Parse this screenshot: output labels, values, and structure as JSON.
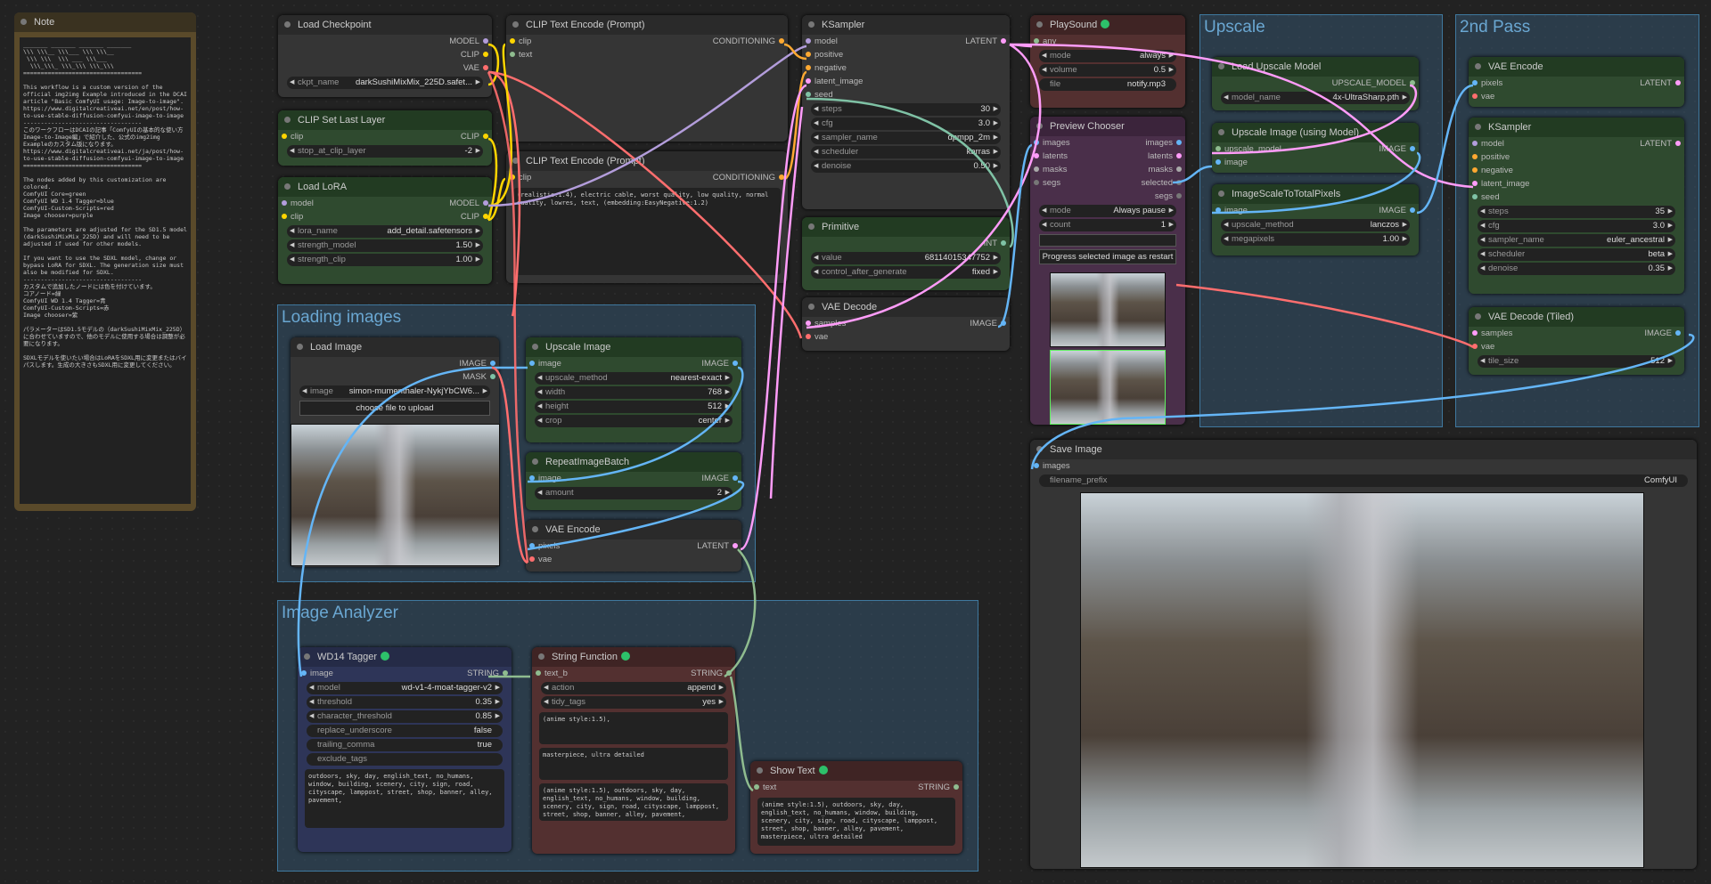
{
  "note": {
    "title": "Note",
    "body": "_______ _______ _______ _______\n\\\\\\ \\\\\\__ \\\\\\___ \\\\\\ \\\\\\__\n \\\\\\ \\\\\\  \\\\\\ ___ \\\\\\___\n  \\\\\\_\\\\\\_ \\\\\\_\\\\\\ \\\\\\_\\\\\\\n==================================\n\nThis workflow is a custom version of the official img2img Example introduced in the DCAI article \"Basic ComfyUI usage: Image-to-image\".\nhttps://www.digitalcreativeai.net/en/post/how-to-use-stable-diffusion-comfyui-image-to-image\n----------------------------------\nこのワークフローはDCAIの記事「ComfyUIの基本的な使い方 Image-to-Image編」で紹介した、公式のimg2img Exampleのカスタム版になります。\nhttps://www.digitalcreativeai.net/ja/post/how-to-use-stable-diffusion-comfyui-image-to-image\n==================================\n\nThe nodes added by this customization are colored.\nComfyUI Core=green\nComfyUI WD 1.4 Tagger=blue\nComfyUI-Custom-Scripts=red\nImage chooser=purple\n\nThe parameters are adjusted for the SD1.5 model (darkSushiMixMix_225D) and will need to be adjusted if used for other models.\n\nIf you want to use the SDXL model, change or bypass LoRA for SDXL. The generation size must also be modified for SDXL.\n----------------------------------\nカスタムで追加したノードには色を付けています。\nコアノード=緑\nComfyUI WD 1.4 Tagger=青\nComfyUI-Custom-Scripts=赤\nImage chooser=紫\n\nパラメーターはSD1.5モデルの（darkSushiMixMix_225D）に合わせていますので、他のモデルに使用する場合は調整が必要になります。\n\nSDXLモデルを使いたい場合はLoRAをSDXL用に変更またはバイパスします。生成の大きさもSDXL用に変更してください。"
  },
  "groups": {
    "loading": "Loading images",
    "analyzer": "Image Analyzer",
    "upscale": "Upscale",
    "second": "2nd Pass"
  },
  "load_checkpoint": {
    "title": "Load Checkpoint",
    "outputs": [
      "MODEL",
      "CLIP",
      "VAE"
    ],
    "ckpt_label": "ckpt_name",
    "ckpt_value": "darkSushiMixMix_225D.safet..."
  },
  "clip_last_layer": {
    "title": "CLIP Set Last Layer",
    "in": "clip",
    "out": "CLIP",
    "stop_label": "stop_at_clip_layer",
    "stop_value": "-2"
  },
  "load_lora": {
    "title": "Load LoRA",
    "in_model": "model",
    "in_clip": "clip",
    "out_model": "MODEL",
    "out_clip": "CLIP",
    "lora_label": "lora_name",
    "lora_value": "add_detail.safetensors",
    "sm_label": "strength_model",
    "sm_value": "1.50",
    "sc_label": "strength_clip",
    "sc_value": "1.00"
  },
  "clip_pos": {
    "title": "CLIP Text Encode (Prompt)",
    "in_clip": "clip",
    "in_text": "text",
    "out": "CONDITIONING"
  },
  "clip_neg": {
    "title": "CLIP Text Encode (Prompt)",
    "in_clip": "clip",
    "out": "CONDITIONING",
    "text": "(realistic:1.4), electric cable, worst quality, low quality, normal quality, lowres, text, (embedding:EasyNegative:1.2)"
  },
  "ksampler": {
    "title": "KSampler",
    "inputs": [
      "model",
      "positive",
      "negative",
      "latent_image",
      "seed"
    ],
    "out": "LATENT",
    "widgets": [
      {
        "label": "steps",
        "value": "30"
      },
      {
        "label": "cfg",
        "value": "3.0"
      },
      {
        "label": "sampler_name",
        "value": "dpmpp_2m"
      },
      {
        "label": "scheduler",
        "value": "karras"
      },
      {
        "label": "denoise",
        "value": "0.50"
      }
    ]
  },
  "primitive": {
    "title": "Primitive",
    "out": "INT",
    "value_label": "value",
    "value": "68114015347752",
    "cag_label": "control_after_generate",
    "cag_value": "fixed"
  },
  "vae_decode": {
    "title": "VAE Decode",
    "in_samples": "samples",
    "in_vae": "vae",
    "out": "IMAGE"
  },
  "playsound": {
    "title": "PlaySound",
    "in": "any",
    "mode_label": "mode",
    "mode_value": "always",
    "volume_label": "volume",
    "volume_value": "0.5",
    "file_label": "file",
    "file_value": "notify.mp3"
  },
  "preview_chooser": {
    "title": "Preview Chooser",
    "inputs": [
      "images",
      "latents",
      "masks",
      "segs"
    ],
    "outputs": [
      "images",
      "latents",
      "masks",
      "selected",
      "segs"
    ],
    "mode_label": "mode",
    "mode_value": "Always pause",
    "count_label": "count",
    "count_value": "1",
    "button": "Progress selected image as restart"
  },
  "load_upscale_model": {
    "title": "Load Upscale Model",
    "out": "UPSCALE_MODEL",
    "label": "model_name",
    "value": "4x-UltraSharp.pth"
  },
  "upscale_using_model": {
    "title": "Upscale Image (using Model)",
    "in_model": "upscale_model",
    "in_image": "image",
    "out": "IMAGE"
  },
  "scale_total": {
    "title": "ImageScaleToTotalPixels",
    "in": "image",
    "out": "IMAGE",
    "m_label": "upscale_method",
    "m_value": "lanczos",
    "mp_label": "megapixels",
    "mp_value": "1.00"
  },
  "vae_encode2": {
    "title": "VAE Encode",
    "in_pixels": "pixels",
    "in_vae": "vae",
    "out": "LATENT"
  },
  "ksampler2": {
    "title": "KSampler",
    "inputs": [
      "model",
      "positive",
      "negative",
      "latent_image",
      "seed"
    ],
    "out": "LATENT",
    "widgets": [
      {
        "label": "steps",
        "value": "35"
      },
      {
        "label": "cfg",
        "value": "3.0"
      },
      {
        "label": "sampler_name",
        "value": "euler_ancestral"
      },
      {
        "label": "scheduler",
        "value": "beta"
      },
      {
        "label": "denoise",
        "value": "0.35"
      }
    ]
  },
  "vae_decode_tiled": {
    "title": "VAE Decode (Tiled)",
    "in_samples": "samples",
    "in_vae": "vae",
    "out": "IMAGE",
    "tile_label": "tile_size",
    "tile_value": "512"
  },
  "load_image": {
    "title": "Load Image",
    "out_image": "IMAGE",
    "out_mask": "MASK",
    "label": "image",
    "value": "simon-mumenthaler-NykjYbCW6...",
    "button": "choose file to upload"
  },
  "upscale_image": {
    "title": "Upscale Image",
    "in": "image",
    "out": "IMAGE",
    "widgets": [
      {
        "label": "upscale_method",
        "value": "nearest-exact"
      },
      {
        "label": "width",
        "value": "768"
      },
      {
        "label": "height",
        "value": "512"
      },
      {
        "label": "crop",
        "value": "center"
      }
    ]
  },
  "repeat_batch": {
    "title": "RepeatImageBatch",
    "in": "image",
    "out": "IMAGE",
    "label": "amount",
    "value": "2"
  },
  "vae_encode": {
    "title": "VAE Encode",
    "in_pixels": "pixels",
    "in_vae": "vae",
    "out": "LATENT"
  },
  "wd14": {
    "title": "WD14 Tagger",
    "in": "image",
    "out": "STRING",
    "widgets": [
      {
        "label": "model",
        "value": "wd-v1-4-moat-tagger-v2"
      },
      {
        "label": "threshold",
        "value": "0.35"
      },
      {
        "label": "character_threshold",
        "value": "0.85"
      }
    ],
    "ru_label": "replace_underscore",
    "ru_value": "false",
    "tc_label": "trailing_comma",
    "tc_value": "true",
    "ex_label": "exclude_tags",
    "text": "outdoors, sky, day, english_text, no_humans, window, building, scenery, city, sign, road, cityscape, lamppost, street, shop, banner, alley, pavement,"
  },
  "string_function": {
    "title": "String Function",
    "in": "text_b",
    "out": "STRING",
    "a_label": "action",
    "a_value": "append",
    "t_label": "tidy_tags",
    "t_value": "yes",
    "text1": "(anime style:1.5),",
    "text2": "masterpiece, ultra detailed",
    "text3": "(anime style:1.5), outdoors, sky, day, english_text, no_humans, window, building, scenery, city, sign, road, cityscape, lamppost, street, shop, banner, alley, pavement,"
  },
  "show_text": {
    "title": "Show Text",
    "in": "text",
    "out": "STRING",
    "text": "(anime style:1.5), outdoors, sky, day, english_text, no_humans, window, building, scenery, city, sign, road, cityscape, lamppost, street, shop, banner, alley, pavement, masterpiece, ultra detailed"
  },
  "save_image": {
    "title": "Save Image",
    "in": "images",
    "prefix_label": "filename_prefix",
    "prefix_value": "ComfyUI"
  },
  "colors": {
    "model": "#b39ddb",
    "clip": "#ffd500",
    "vae": "#ff6e6e",
    "conditioning": "#ffa931",
    "latent": "#ff9cf9",
    "image": "#64b5f6",
    "int": "#7fc2a5",
    "string": "#8fbc8f"
  }
}
